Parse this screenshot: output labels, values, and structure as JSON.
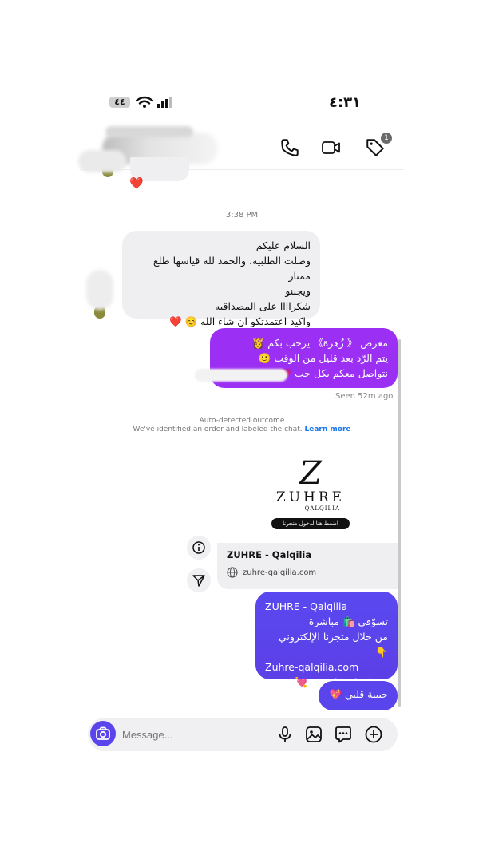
{
  "status_bar": {
    "time": "٤:٣١",
    "battery": "٤٤"
  },
  "header": {
    "tag_badge_count": "1"
  },
  "thread": {
    "top_reaction": "❤️",
    "timestamp": "3:38 PM",
    "incoming": {
      "lines": [
        "السلام عليكم",
        "وصلت الطلبيه، والحمد لله قياسها طلع ممتاز",
        "ويجننو",
        "شكراااا على المصداقيه",
        "واكيد اعتمدتكو ان شاء الله ☺️ ❤️"
      ]
    },
    "outgoing_welcome": {
      "lines": [
        "معرض 《 زُهرة》 يرحب بكم 👸",
        "يتم الرّد بعد قليل من الوقت 🙂",
        "نتواصل معكم بكل حب 💗"
      ]
    },
    "seen": "Seen 52m ago",
    "auto_detected": {
      "title": "Auto-detected outcome",
      "text": "We've identified an order and labeled the chat.",
      "link": "Learn more"
    },
    "link_preview": {
      "logo_letter": "Z",
      "logo_name": "ZUHRE",
      "logo_sub": "QALQILIA",
      "logo_button": "اضغط هنا لدخول متجرنا",
      "title": "ZUHRE - Qalqilia",
      "url": "zuhre-qalqilia.com"
    },
    "outgoing_store": {
      "line1": "ZUHRE - Qalqilia",
      "line2": "تسوّقي 🛍️ مباشرة",
      "line3": "من خلال متجرنا الإلكتروني 👇",
      "line4": "Zuhre-qalqilia.com",
      "line5": "ونساعدك بكل حب 💘"
    },
    "outgoing_last": "حبيبة قلبي 💖"
  },
  "composer": {
    "placeholder": "Message..."
  },
  "colors": {
    "incoming_bubble": "#efeff1",
    "purple_bubble": "#9b2ff3",
    "indigo_bubble": "#5a45ec",
    "link_blue": "#1877f2"
  }
}
